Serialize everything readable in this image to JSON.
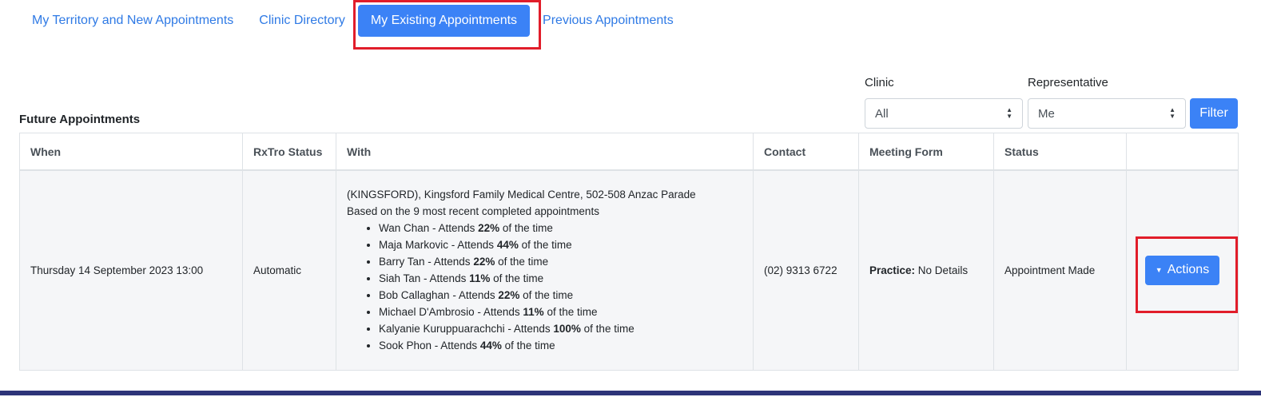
{
  "tabs": [
    {
      "label": "My Territory and New Appointments"
    },
    {
      "label": "Clinic Directory"
    },
    {
      "label": "My Existing Appointments"
    },
    {
      "label": "Previous Appointments"
    }
  ],
  "filters": {
    "clinic_label": "Clinic",
    "clinic_value": "All",
    "rep_label": "Representative",
    "rep_value": "Me",
    "filter_button": "Filter"
  },
  "section_title": "Future Appointments",
  "table": {
    "headers": [
      "When",
      "RxTro Status",
      "With",
      "Contact",
      "Meeting Form",
      "Status",
      ""
    ],
    "row": {
      "when": "Thursday 14 September 2023 13:00",
      "rxtro_status": "Automatic",
      "with_line1": "(KINGSFORD), Kingsford Family Medical Centre, 502-508 Anzac Parade",
      "with_line2": "Based on the 9 most recent completed appointments",
      "attendees": [
        {
          "name": "Wan Chan - Attends ",
          "pct": "22%",
          "suffix": " of the time"
        },
        {
          "name": "Maja Markovic - Attends ",
          "pct": "44%",
          "suffix": " of the time"
        },
        {
          "name": "Barry Tan - Attends ",
          "pct": "22%",
          "suffix": " of the time"
        },
        {
          "name": "Siah Tan - Attends ",
          "pct": "11%",
          "suffix": " of the time"
        },
        {
          "name": "Bob Callaghan - Attends ",
          "pct": "22%",
          "suffix": " of the time"
        },
        {
          "name": "Michael D'Ambrosio - Attends ",
          "pct": "11%",
          "suffix": " of the time"
        },
        {
          "name": "Kalyanie Kuruppuarachchi - Attends ",
          "pct": "100%",
          "suffix": " of the time"
        },
        {
          "name": "Sook Phon - Attends ",
          "pct": "44%",
          "suffix": " of the time"
        }
      ],
      "contact": "(02) 9313 6722",
      "meeting_form_label": "Practice:",
      "meeting_form_value": " No Details",
      "status": "Appointment Made",
      "actions_label": "Actions"
    }
  },
  "colors": {
    "accent": "#3b82f6",
    "link": "#2f7ae5",
    "highlight": "#e11d2a",
    "footer": "#2d3479"
  }
}
